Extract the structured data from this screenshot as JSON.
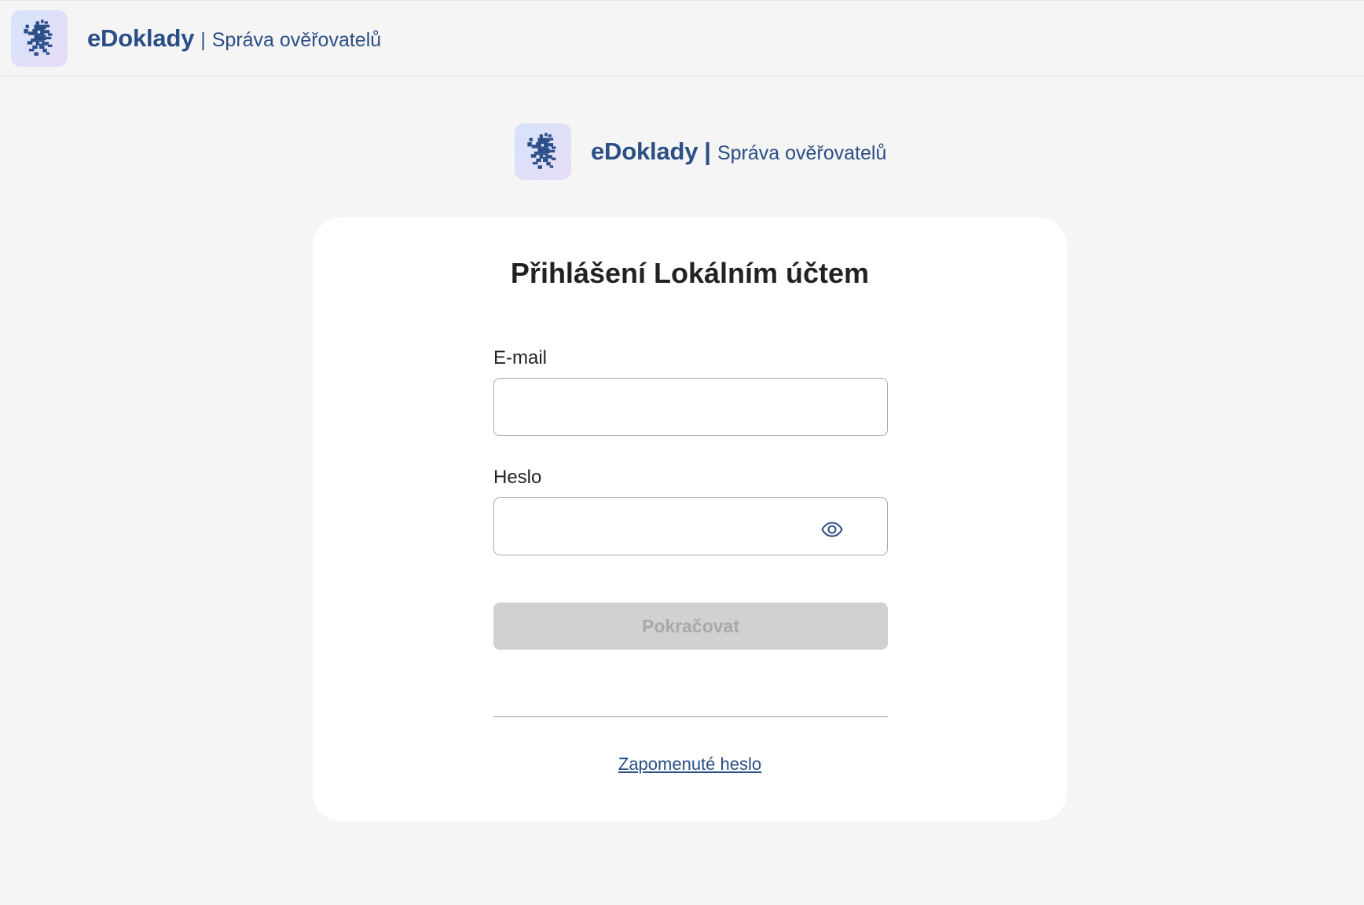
{
  "header": {
    "brand_name": "eDoklady",
    "separator": "|",
    "subtitle": "Správa ověřovatelů",
    "logo_icon": "lion-emblem-icon"
  },
  "center_brand": {
    "brand_name": "eDoklady",
    "separator": "|",
    "subtitle": "Správa ověřovatelů"
  },
  "login": {
    "title": "Přihlášení Lokálním účtem",
    "email_label": "E-mail",
    "email_value": "",
    "password_label": "Heslo",
    "password_value": "",
    "show_password_icon": "eye-icon",
    "submit_label": "Pokračovat",
    "forgot_link": "Zapomenuté heslo"
  },
  "colors": {
    "brand": "#2a4e86",
    "page_bg": "#f5f5f5",
    "card_bg": "#ffffff",
    "button_disabled_bg": "#d1d1d1",
    "button_disabled_text": "#a8a8a8"
  }
}
